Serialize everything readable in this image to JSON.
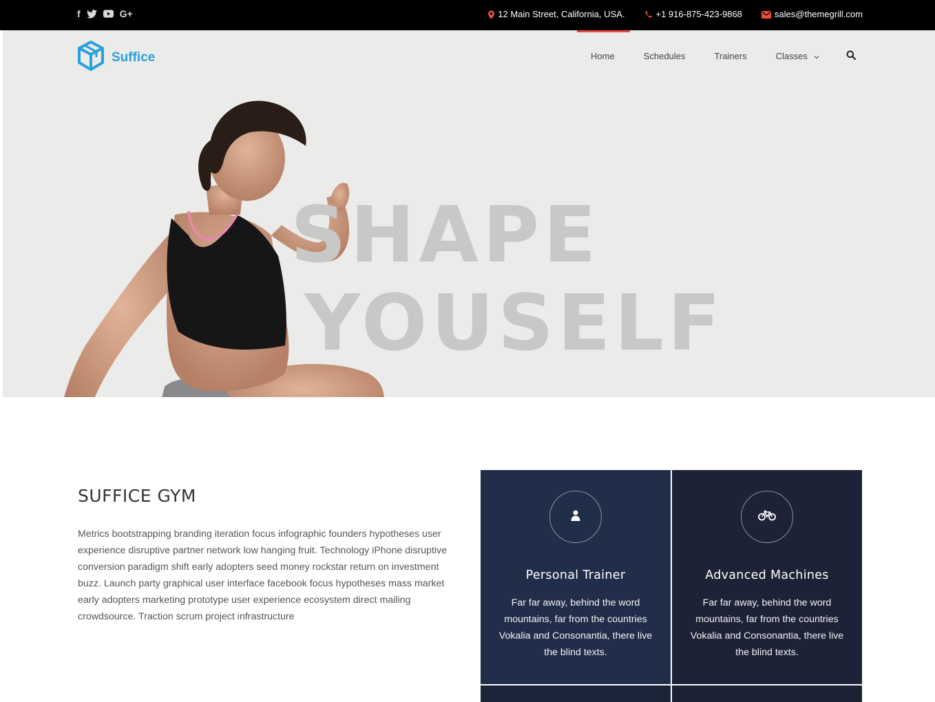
{
  "topbar": {
    "social": [
      {
        "icon": "facebook-icon",
        "glyph": "f"
      },
      {
        "icon": "twitter-icon"
      },
      {
        "icon": "youtube-icon"
      },
      {
        "icon": "google-plus-icon",
        "glyph": "G+"
      }
    ],
    "address": "12 Main Street, California, USA.",
    "phone": "+1 916-875-423-9868",
    "email": "sales@themegrill.com",
    "icon_color": "#e74c3c"
  },
  "header": {
    "logo_text": "Suffice",
    "brand_color": "#2aa1dd",
    "nav": [
      {
        "label": "Home",
        "active": true
      },
      {
        "label": "Schedules"
      },
      {
        "label": "Trainers"
      },
      {
        "label": "Classes",
        "has_dropdown": true
      }
    ],
    "active_color": "#e74c3c"
  },
  "hero": {
    "line1": "SHAPE",
    "line2": "YOUSELF"
  },
  "about": {
    "title": "SUFFICE GYM",
    "text": "Metrics bootstrapping branding iteration focus infographic founders hypotheses user experience disruptive partner network low hanging fruit. Technology iPhone disruptive conversion paradigm shift early adopters seed money rockstar return on investment buzz. Launch party graphical user interface facebook focus hypotheses mass market early adopters marketing prototype user experience ecosystem direct mailing crowdsource. Traction scrum project infrastructure"
  },
  "features": [
    {
      "icon": "user-icon",
      "title": "Personal Trainer",
      "text": "Far far away, behind the word mountains, far from the countries Vokalia and Consonantia, there live the blind texts."
    },
    {
      "icon": "bicycle-icon",
      "title": "Advanced Machines",
      "text": "Far far away, behind the word mountains, far from the countries Vokalia and Consonantia, there live the blind texts."
    }
  ]
}
